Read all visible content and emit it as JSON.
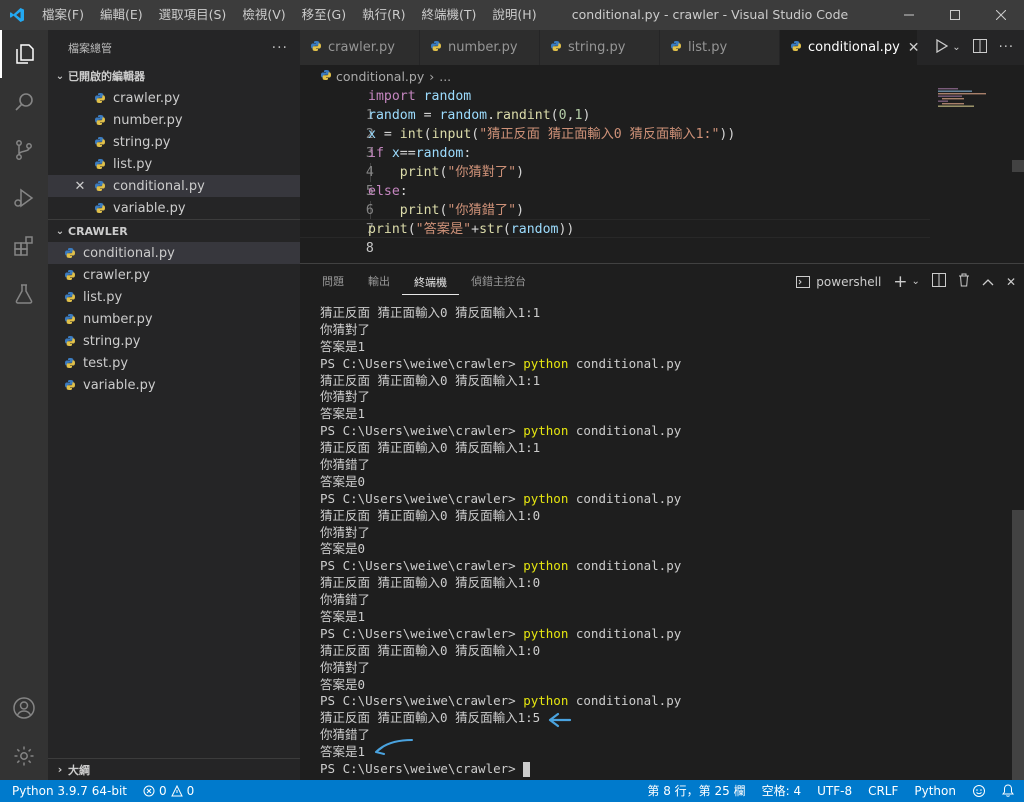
{
  "titlebar": {
    "menus": [
      "檔案(F)",
      "編輯(E)",
      "選取項目(S)",
      "檢視(V)",
      "移至(G)",
      "執行(R)",
      "終端機(T)",
      "說明(H)"
    ],
    "window_title": "conditional.py - crawler - Visual Studio Code"
  },
  "sidebar": {
    "header": "檔案總管",
    "open_editors_title": "已開啟的編輯器",
    "open_editors": [
      {
        "name": "crawler.py"
      },
      {
        "name": "number.py"
      },
      {
        "name": "string.py"
      },
      {
        "name": "list.py"
      },
      {
        "name": "conditional.py"
      },
      {
        "name": "variable.py"
      }
    ],
    "folder_title": "CRAWLER",
    "files": [
      "conditional.py",
      "crawler.py",
      "list.py",
      "number.py",
      "string.py",
      "test.py",
      "variable.py"
    ],
    "outline_title": "大綱"
  },
  "tabs": [
    {
      "label": "crawler.py"
    },
    {
      "label": "number.py"
    },
    {
      "label": "string.py"
    },
    {
      "label": "list.py"
    },
    {
      "label": "conditional.py"
    }
  ],
  "breadcrumb": {
    "file": "conditional.py",
    "more": "..."
  },
  "editor": {
    "line_numbers": [
      "1",
      "2",
      "3",
      "4",
      "5",
      "6",
      "7",
      "8"
    ],
    "code": {
      "l1_kw": "import",
      "l1_mod": "random",
      "l2_var": "random",
      "l2_eq": " = ",
      "l2_mod": "random",
      "l2_fn": "randint",
      "l2_open": "(",
      "l2_a": "0",
      "l2_c": ",",
      "l2_b": "1",
      "l2_close": ")",
      "l3_var": "x",
      "l3_eq": " = ",
      "l3_fn1": "int",
      "l3_p1": "(",
      "l3_fn2": "input",
      "l3_p2": "(",
      "l3_str": "\"猜正反面 猜正面輸入0 猜反面輸入1:\"",
      "l3_p3": "))",
      "l4_kw": "if",
      "l4_var1": "x",
      "l4_op": "==",
      "l4_var2": "random",
      "l4_colon": ":",
      "l5_fn": "print",
      "l5_p1": "(",
      "l5_str": "\"你猜對了\"",
      "l5_p2": ")",
      "l6_kw": "else",
      "l6_colon": ":",
      "l7_fn": "print",
      "l7_p1": "(",
      "l7_str": "\"你猜錯了\"",
      "l7_p2": ")",
      "l8_fn": "print",
      "l8_p1": "(",
      "l8_str": "\"答案是\"",
      "l8_plus": "+",
      "l8_fn2": "str",
      "l8_p2": "(",
      "l8_var": "random",
      "l8_p3": "))"
    }
  },
  "panel": {
    "tabs": [
      "問題",
      "輸出",
      "終端機",
      "偵錯主控台"
    ],
    "active_tab": "終端機",
    "shell": "powershell"
  },
  "terminal": {
    "prompt": "PS C:\\Users\\weiwe\\crawler> ",
    "cmd": "python",
    "arg": " conditional.py",
    "input_prompt": "猜正反面 猜正面輸入0 猜反面輸入1:",
    "right": "你猜對了",
    "wrong": "你猜錯了",
    "answer": "答案是",
    "sessions": [
      {
        "input": "1",
        "result": "你猜對了",
        "answer": "1"
      },
      {
        "input": "1",
        "result": "你猜對了",
        "answer": "1"
      },
      {
        "input": "1",
        "result": "你猜錯了",
        "answer": "0"
      },
      {
        "input": "0",
        "result": "你猜對了",
        "answer": "0"
      },
      {
        "input": "0",
        "result": "你猜錯了",
        "answer": "1"
      },
      {
        "input": "0",
        "result": "你猜對了",
        "answer": "0"
      },
      {
        "input": "5",
        "result": "你猜錯了",
        "answer": "1"
      }
    ]
  },
  "statusbar": {
    "python": "Python 3.9.7 64-bit",
    "errors": "0",
    "warnings": "0",
    "position": "第 8 行，第 25 欄",
    "spaces": "空格: 4",
    "encoding": "UTF-8",
    "eol": "CRLF",
    "language": "Python"
  },
  "colors": {
    "accent": "#007acc",
    "annotation": "#4aa3df"
  }
}
